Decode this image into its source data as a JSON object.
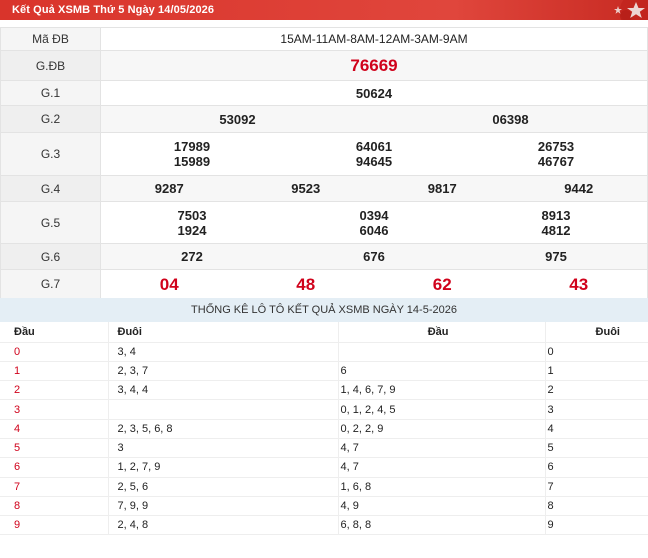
{
  "header": {
    "title": "Kết Quả XSMB Thứ 5 Ngày 14/05/2026"
  },
  "results": {
    "code_label": "Mã ĐB",
    "code_value": "15AM-11AM-8AM-12AM-3AM-9AM",
    "prizes": {
      "gdb": {
        "label": "G.ĐB",
        "numbers": [
          "76669"
        ]
      },
      "g1": {
        "label": "G.1",
        "numbers": [
          "50624"
        ]
      },
      "g2": {
        "label": "G.2",
        "numbers": [
          "53092",
          "06398"
        ]
      },
      "g3": {
        "label": "G.3",
        "numbers": [
          "17989",
          "15989",
          "64061",
          "94645",
          "26753",
          "46767"
        ]
      },
      "g4": {
        "label": "G.4",
        "numbers": [
          "9287",
          "9523",
          "9817",
          "9442"
        ]
      },
      "g5": {
        "label": "G.5",
        "numbers": [
          "7503",
          "1924",
          "0394",
          "6046",
          "8913",
          "4812"
        ]
      },
      "g6": {
        "label": "G.6",
        "numbers": [
          "272",
          "676",
          "975"
        ]
      },
      "g7": {
        "label": "G.7",
        "numbers": [
          "04",
          "48",
          "62",
          "43"
        ]
      }
    }
  },
  "stats": {
    "title": "THỐNG KÊ LÔ TÔ KẾT QUẢ XSMB NGÀY 14-5-2026",
    "headers": [
      "Đầu",
      "Đuôi",
      "Đầu",
      "Đuôi"
    ],
    "rows": [
      {
        "dau": "0",
        "duoi": "3, 4",
        "dau2": "",
        "duoi2": "0"
      },
      {
        "dau": "1",
        "duoi": "2, 3, 7",
        "dau2": "6",
        "duoi2": "1"
      },
      {
        "dau": "2",
        "duoi": "3, 4, 4",
        "dau2": "1, 4, 6, 7, 9",
        "duoi2": "2"
      },
      {
        "dau": "3",
        "duoi": "",
        "dau2": "0, 1, 2, 4, 5",
        "duoi2": "3"
      },
      {
        "dau": "4",
        "duoi": "2, 3, 5, 6, 8",
        "dau2": "0, 2, 2, 9",
        "duoi2": "4"
      },
      {
        "dau": "5",
        "duoi": "3",
        "dau2": "4, 7",
        "duoi2": "5"
      },
      {
        "dau": "6",
        "duoi": "1, 2, 7, 9",
        "dau2": "4, 7",
        "duoi2": "6"
      },
      {
        "dau": "7",
        "duoi": "2, 5, 6",
        "dau2": "1, 6, 8",
        "duoi2": "7"
      },
      {
        "dau": "8",
        "duoi": "7, 9, 9",
        "dau2": "4, 9",
        "duoi2": "8"
      },
      {
        "dau": "9",
        "duoi": "2, 4, 8",
        "dau2": "6, 8, 8",
        "duoi2": "9"
      }
    ]
  },
  "colors": {
    "header_bg": "#d9342b",
    "accent_red": "#d0021b",
    "stats_title_bg": "#e4eef5"
  },
  "icons": {
    "header_decoration": "star-decoration-icon"
  }
}
